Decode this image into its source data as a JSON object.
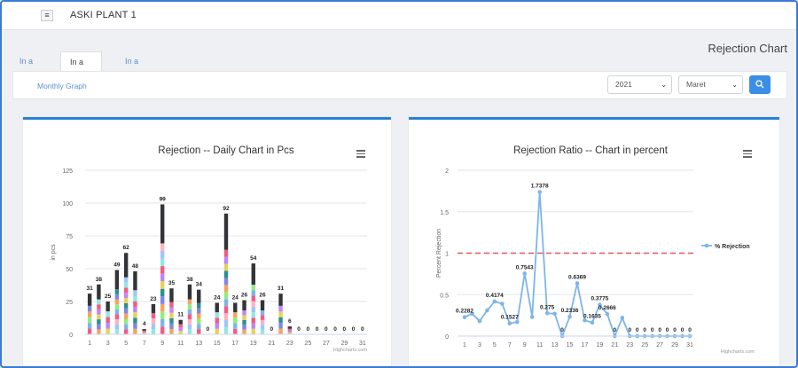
{
  "app": {
    "title": "ASKI PLANT 1",
    "menu_icon": "hamburger-icon"
  },
  "page": {
    "title": "Rejection Chart"
  },
  "tabs": [
    {
      "label": "In a Year",
      "active": false
    },
    {
      "label": "In a Month",
      "active": true
    },
    {
      "label": "In a Day",
      "active": false
    }
  ],
  "toolbar": {
    "link_label": "Monthly Graph",
    "year": "2021",
    "month": "Maret",
    "go_icon": "search-icon",
    "accent": "#3a8ee6"
  },
  "chart_data": [
    {
      "type": "bar",
      "stacked": true,
      "title": "Rejection -- Daily Chart in Pcs",
      "ylabel": "in pcs",
      "xlabel": "",
      "ylim": [
        0,
        125
      ],
      "y_ticks": [
        0,
        25,
        50,
        75,
        100,
        125
      ],
      "x_tick_labels": [
        "1",
        "3",
        "5",
        "7",
        "9",
        "11",
        "13",
        "15",
        "17",
        "19",
        "21",
        "23",
        "25",
        "27",
        "29",
        "31"
      ],
      "categories": [
        "1",
        "2",
        "3",
        "4",
        "5",
        "6",
        "7",
        "8",
        "9",
        "10",
        "11",
        "12",
        "13",
        "14",
        "15",
        "16",
        "17",
        "18",
        "19",
        "20",
        "21",
        "22",
        "23",
        "24",
        "25",
        "26",
        "27",
        "28",
        "29",
        "30",
        "31"
      ],
      "totals": [
        31,
        38,
        25,
        49,
        62,
        48,
        4,
        23,
        99,
        35,
        11,
        38,
        34,
        0,
        24,
        92,
        24,
        26,
        54,
        26,
        0,
        31,
        6,
        0,
        0,
        0,
        0,
        0,
        0,
        0,
        0
      ],
      "credits": "Highcharts.com",
      "grid": true,
      "legend": "none"
    },
    {
      "type": "line",
      "title": "Rejection Ratio -- Chart in percent",
      "ylabel": "Percent Rejection",
      "xlabel": "",
      "ylim": [
        0,
        2
      ],
      "y_ticks": [
        0,
        0.5,
        1,
        1.5,
        2
      ],
      "x_tick_labels": [
        "1",
        "3",
        "5",
        "7",
        "9",
        "11",
        "13",
        "15",
        "17",
        "19",
        "21",
        "23",
        "25",
        "27",
        "29",
        "31"
      ],
      "x": [
        1,
        2,
        3,
        4,
        5,
        6,
        7,
        8,
        9,
        10,
        11,
        12,
        13,
        14,
        15,
        16,
        17,
        18,
        19,
        20,
        21,
        22,
        23,
        24,
        25,
        26,
        27,
        28,
        29,
        30,
        31
      ],
      "series": [
        {
          "name": "% Rejection",
          "color": "#7cb5ec",
          "values": [
            0.2282,
            0.27,
            0.18,
            0.31,
            0.4174,
            0.39,
            0.1527,
            0.17,
            0.7543,
            0.23,
            1.7378,
            0.275,
            0.27,
            0.0,
            0.2336,
            0.6369,
            0.19,
            0.1635,
            0.3775,
            0.2666,
            0.0,
            0.22,
            0.0,
            0.0,
            0.0,
            0.0,
            0.0,
            0.0,
            0.0,
            0.0,
            0.0
          ]
        }
      ],
      "point_labels": [
        {
          "day": 1,
          "text": "0.2282"
        },
        {
          "day": 5,
          "text": "0.4174"
        },
        {
          "day": 7,
          "text": "0.1527"
        },
        {
          "day": 9,
          "text": "0.7543"
        },
        {
          "day": 11,
          "text": "1.7378"
        },
        {
          "day": 12,
          "text": "0.275"
        },
        {
          "day": 14,
          "text": "0"
        },
        {
          "day": 15,
          "text": "0.2336"
        },
        {
          "day": 16,
          "text": "0.6369"
        },
        {
          "day": 18,
          "text": "0.1635"
        },
        {
          "day": 19,
          "text": "0.3775"
        },
        {
          "day": 20,
          "text": "0.2666"
        },
        {
          "day": 21,
          "text": "0"
        },
        {
          "day": 23,
          "text": "0"
        },
        {
          "day": 24,
          "text": "0"
        },
        {
          "day": 25,
          "text": "0"
        },
        {
          "day": 26,
          "text": "0"
        },
        {
          "day": 27,
          "text": "0"
        },
        {
          "day": 28,
          "text": "0"
        },
        {
          "day": 29,
          "text": "0"
        },
        {
          "day": 30,
          "text": "0"
        },
        {
          "day": 31,
          "text": "0"
        }
      ],
      "reference_line": {
        "value": 1,
        "color": "#e05a5a",
        "style": "dashed"
      },
      "legend": "right",
      "credits": "Highcharts.com",
      "grid": true
    }
  ]
}
